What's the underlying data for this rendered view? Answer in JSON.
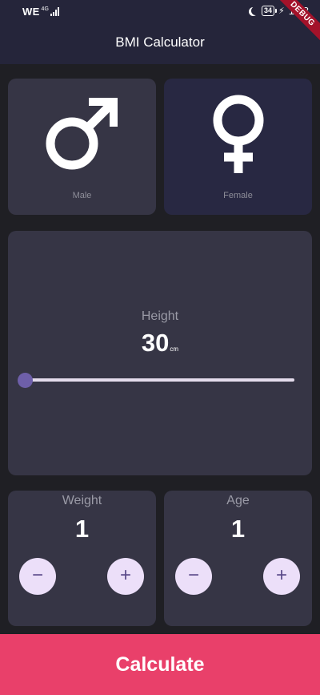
{
  "status_bar": {
    "carrier": "WE",
    "network": "4G",
    "battery": "34",
    "time": "1:58"
  },
  "debug_banner": "DEBUG",
  "app_bar": {
    "title": "BMI Calculator"
  },
  "gender": {
    "male_label": "Male",
    "female_label": "Female",
    "selected": "none"
  },
  "height": {
    "label": "Height",
    "value": "30",
    "unit": "cm",
    "slider_fraction": 0.0
  },
  "weight": {
    "label": "Weight",
    "value": "1"
  },
  "age": {
    "label": "Age",
    "value": "1"
  },
  "calculate_label": "Calculate",
  "colors": {
    "background": "#1f1f24",
    "app_bar": "#25253a",
    "card": "#363545",
    "card_alt": "#282842",
    "accent": "#e9406a",
    "slider_thumb": "#6e5fa9",
    "button": "#ecdff9"
  }
}
